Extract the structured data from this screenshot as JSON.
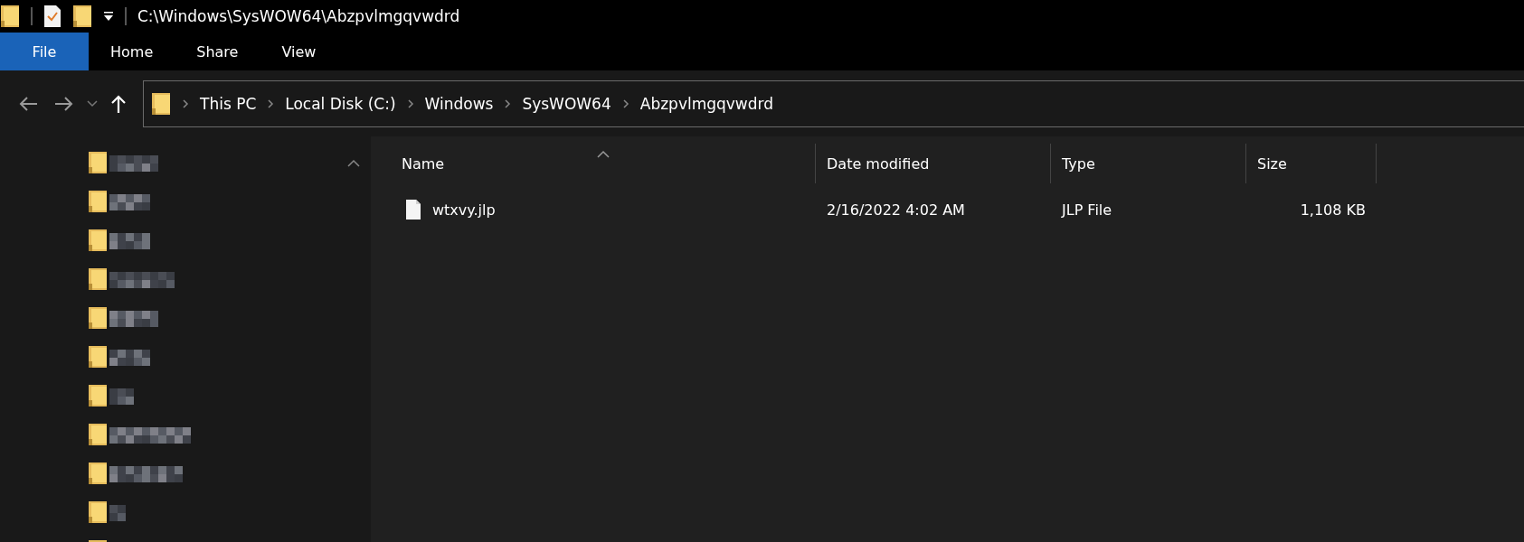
{
  "title_bar": {
    "path": "C:\\Windows\\SysWOW64\\Abzpvlmgqvwdrd"
  },
  "ribbon_tabs": [
    {
      "label": "File",
      "selected": true
    },
    {
      "label": "Home",
      "selected": false
    },
    {
      "label": "Share",
      "selected": false
    },
    {
      "label": "View",
      "selected": false
    }
  ],
  "address_bar": {
    "crumbs": [
      "This PC",
      "Local Disk (C:)",
      "Windows",
      "SysWOW64",
      "Abzpvlmgqvwdrd"
    ]
  },
  "navigation_pane": {
    "items": [
      {
        "kind": "folder"
      },
      {
        "kind": "folder"
      },
      {
        "kind": "folder"
      },
      {
        "kind": "folder"
      },
      {
        "kind": "folder"
      },
      {
        "kind": "folder"
      },
      {
        "kind": "folder"
      },
      {
        "kind": "folder"
      },
      {
        "kind": "folder"
      },
      {
        "kind": "folder"
      },
      {
        "kind": "folder-edge"
      }
    ]
  },
  "file_list": {
    "columns": [
      "Name",
      "Date modified",
      "Type",
      "Size"
    ],
    "rows": [
      {
        "name": "wtxvy.jlp",
        "date_modified": "2/16/2022 4:02 AM",
        "type": "JLP File",
        "size": "1,108 KB",
        "selected": false
      }
    ]
  }
}
